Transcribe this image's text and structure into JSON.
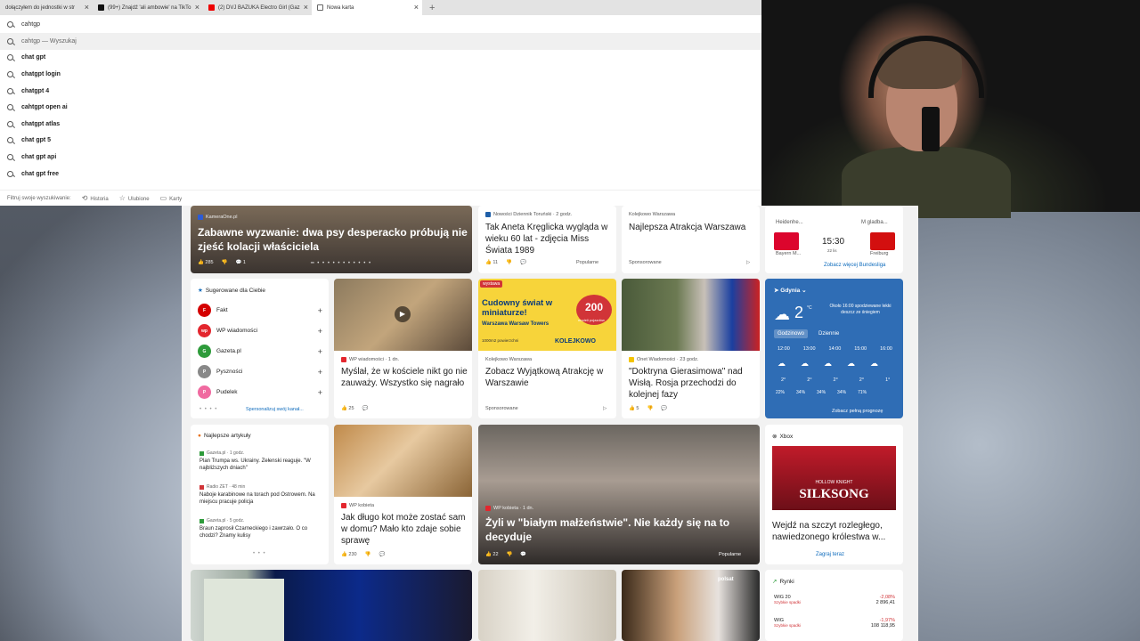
{
  "tabs": [
    {
      "label": "dołączyłem do jednostki w str"
    },
    {
      "label": "(99+) Znajdź 'ali ambowie' na TikTo"
    },
    {
      "label": "(2) DVJ BAZUKA Electro Girl (Gaz"
    },
    {
      "label": "Nowa karta"
    }
  ],
  "search": {
    "query": "cahtgp",
    "first_suggestion": "cahtgp — Wyszukaj",
    "suggestions": [
      "chat gpt",
      "chatgpt login",
      "chatgpt 4",
      "cahtgpt open ai",
      "chatgpt atlas",
      "chat gpt 5",
      "chat gpt api",
      "chat gpt free"
    ],
    "filter_hint": "Filtruj swoje wyszukiwanie:",
    "filters": [
      "Historia",
      "Ulubione",
      "Karty"
    ]
  },
  "feed": {
    "hero": {
      "source": "KameraOne.pl",
      "title": "Zabawne wyzwanie: dwa psy desperacko próbują nie zjeść kolacji właściciela",
      "likes": "285",
      "comments": "1"
    },
    "aneta": {
      "source": "Nowości Dziennik Toruński · 2 godz.",
      "title": "Tak Aneta Kręglicka wygląda w wieku 60 lat - zdjęcia Miss Świata 1989",
      "likes": "11",
      "popular": "Popularne"
    },
    "ad1": {
      "source": "Kolejkowo Warszawa",
      "title": "Najlepsza Atrakcja Warszawa",
      "sponsored": "Sponsorowane"
    },
    "sport": {
      "home": "Heidenhe...",
      "away": "M gladba...",
      "team1": "Bayern M...",
      "team2": "Freiburg",
      "time": "15:30",
      "day": "22 lis",
      "more": "Zobacz więcej Bundesliga"
    },
    "suggested": {
      "header": "Sugerowane dla Ciebie",
      "items": [
        "Fakt",
        "WP wiadomości",
        "Gazeta.pl",
        "Pyszności",
        "Pudelek"
      ],
      "personalize": "Spersonalizuj swój kanał..."
    },
    "church": {
      "source": "WP wiadomości · 1 dn.",
      "title": "Myślał, że w kościele nikt go nie zauważy. Wszystko się nagrało",
      "likes": "25"
    },
    "ad2": {
      "badge": "wystawa",
      "banner": "Cudowny świat w miniaturze!",
      "sub": "Warszawa Warsaw Towers",
      "address": "1000m2 powierzchni",
      "count": "200",
      "count_label": "modeli pojazdów",
      "brand": "KOLEJKOWO",
      "source": "Kolejkowo Warszawa",
      "title": "Zobacz Wyjątkową Atrakcję w Warszawie",
      "sponsored": "Sponsorowane"
    },
    "doctrine": {
      "source": "Onet Wiadomości · 23 godz.",
      "title": "\"Doktryna Gierasimowa\" nad Wisłą. Rosja przechodzi do kolejnej fazy",
      "likes": "5"
    },
    "weather": {
      "city": "Gdynia",
      "temp": "2",
      "unit": "°C",
      "note": "Około 16:00 spodziewane lekki deszcz ze śniegiem",
      "tab1": "Godzinowo",
      "tab2": "Dziennie",
      "hours": [
        "12:00",
        "13:00",
        "14:00",
        "15:00",
        "16:00"
      ],
      "temps": [
        "2°",
        "2°",
        "2°",
        "2°",
        "1°"
      ],
      "precip": [
        "22%",
        "34%",
        "34%",
        "34%",
        "71%"
      ],
      "link": "Zobacz pełną prognozę"
    },
    "best": {
      "header": "Najlepsze artykuły",
      "items": [
        {
          "src": "Gazeta.pl · 1 godz.",
          "title": "Plan Trumpa ws. Ukrainy. Zełenski reaguje. \"W najbliższych dniach\""
        },
        {
          "src": "Radio ZET · 48 min",
          "title": "Naboje karabinowe na torach pod Ostrowem. Na miejscu pracuje policja"
        },
        {
          "src": "Gazeta.pl · 5 godz.",
          "title": "Braun zaprosił Czarneckiego i zawrzało. O co chodzi? Znamy kulisy"
        }
      ]
    },
    "cat": {
      "source": "WP kobieta",
      "title": "Jak długo kot może zostać sam w domu? Mało kto zdaje sobie sprawę",
      "likes": "230"
    },
    "marriage": {
      "source": "WP kobieta · 1 dn.",
      "title": "Żyli w \"białym małżeństwie\". Nie każdy się na to decyduje",
      "likes": "22",
      "popular": "Popularne"
    },
    "xbox": {
      "header": "Xbox",
      "game1": "HOLLOW KNIGHT",
      "game2": "SILKSONG",
      "title": "Wejdź na szczyt rozległego, nawiedzonego królestwa w...",
      "play": "Zagraj teraz"
    },
    "markets": {
      "header": "Rynki",
      "rows": [
        {
          "name": "WIG 20",
          "sub": "Szybkie spadki",
          "change": "-2,08%",
          "value": "2 896,41"
        },
        {
          "name": "WIG",
          "sub": "Szybkie spadki",
          "change": "-1,97%",
          "value": "108 118,95"
        }
      ]
    },
    "polsat": "polsat"
  },
  "colors": {
    "accent": "#0f6cbd",
    "weather_bg": "#2f6db5",
    "red": "#d13438"
  }
}
